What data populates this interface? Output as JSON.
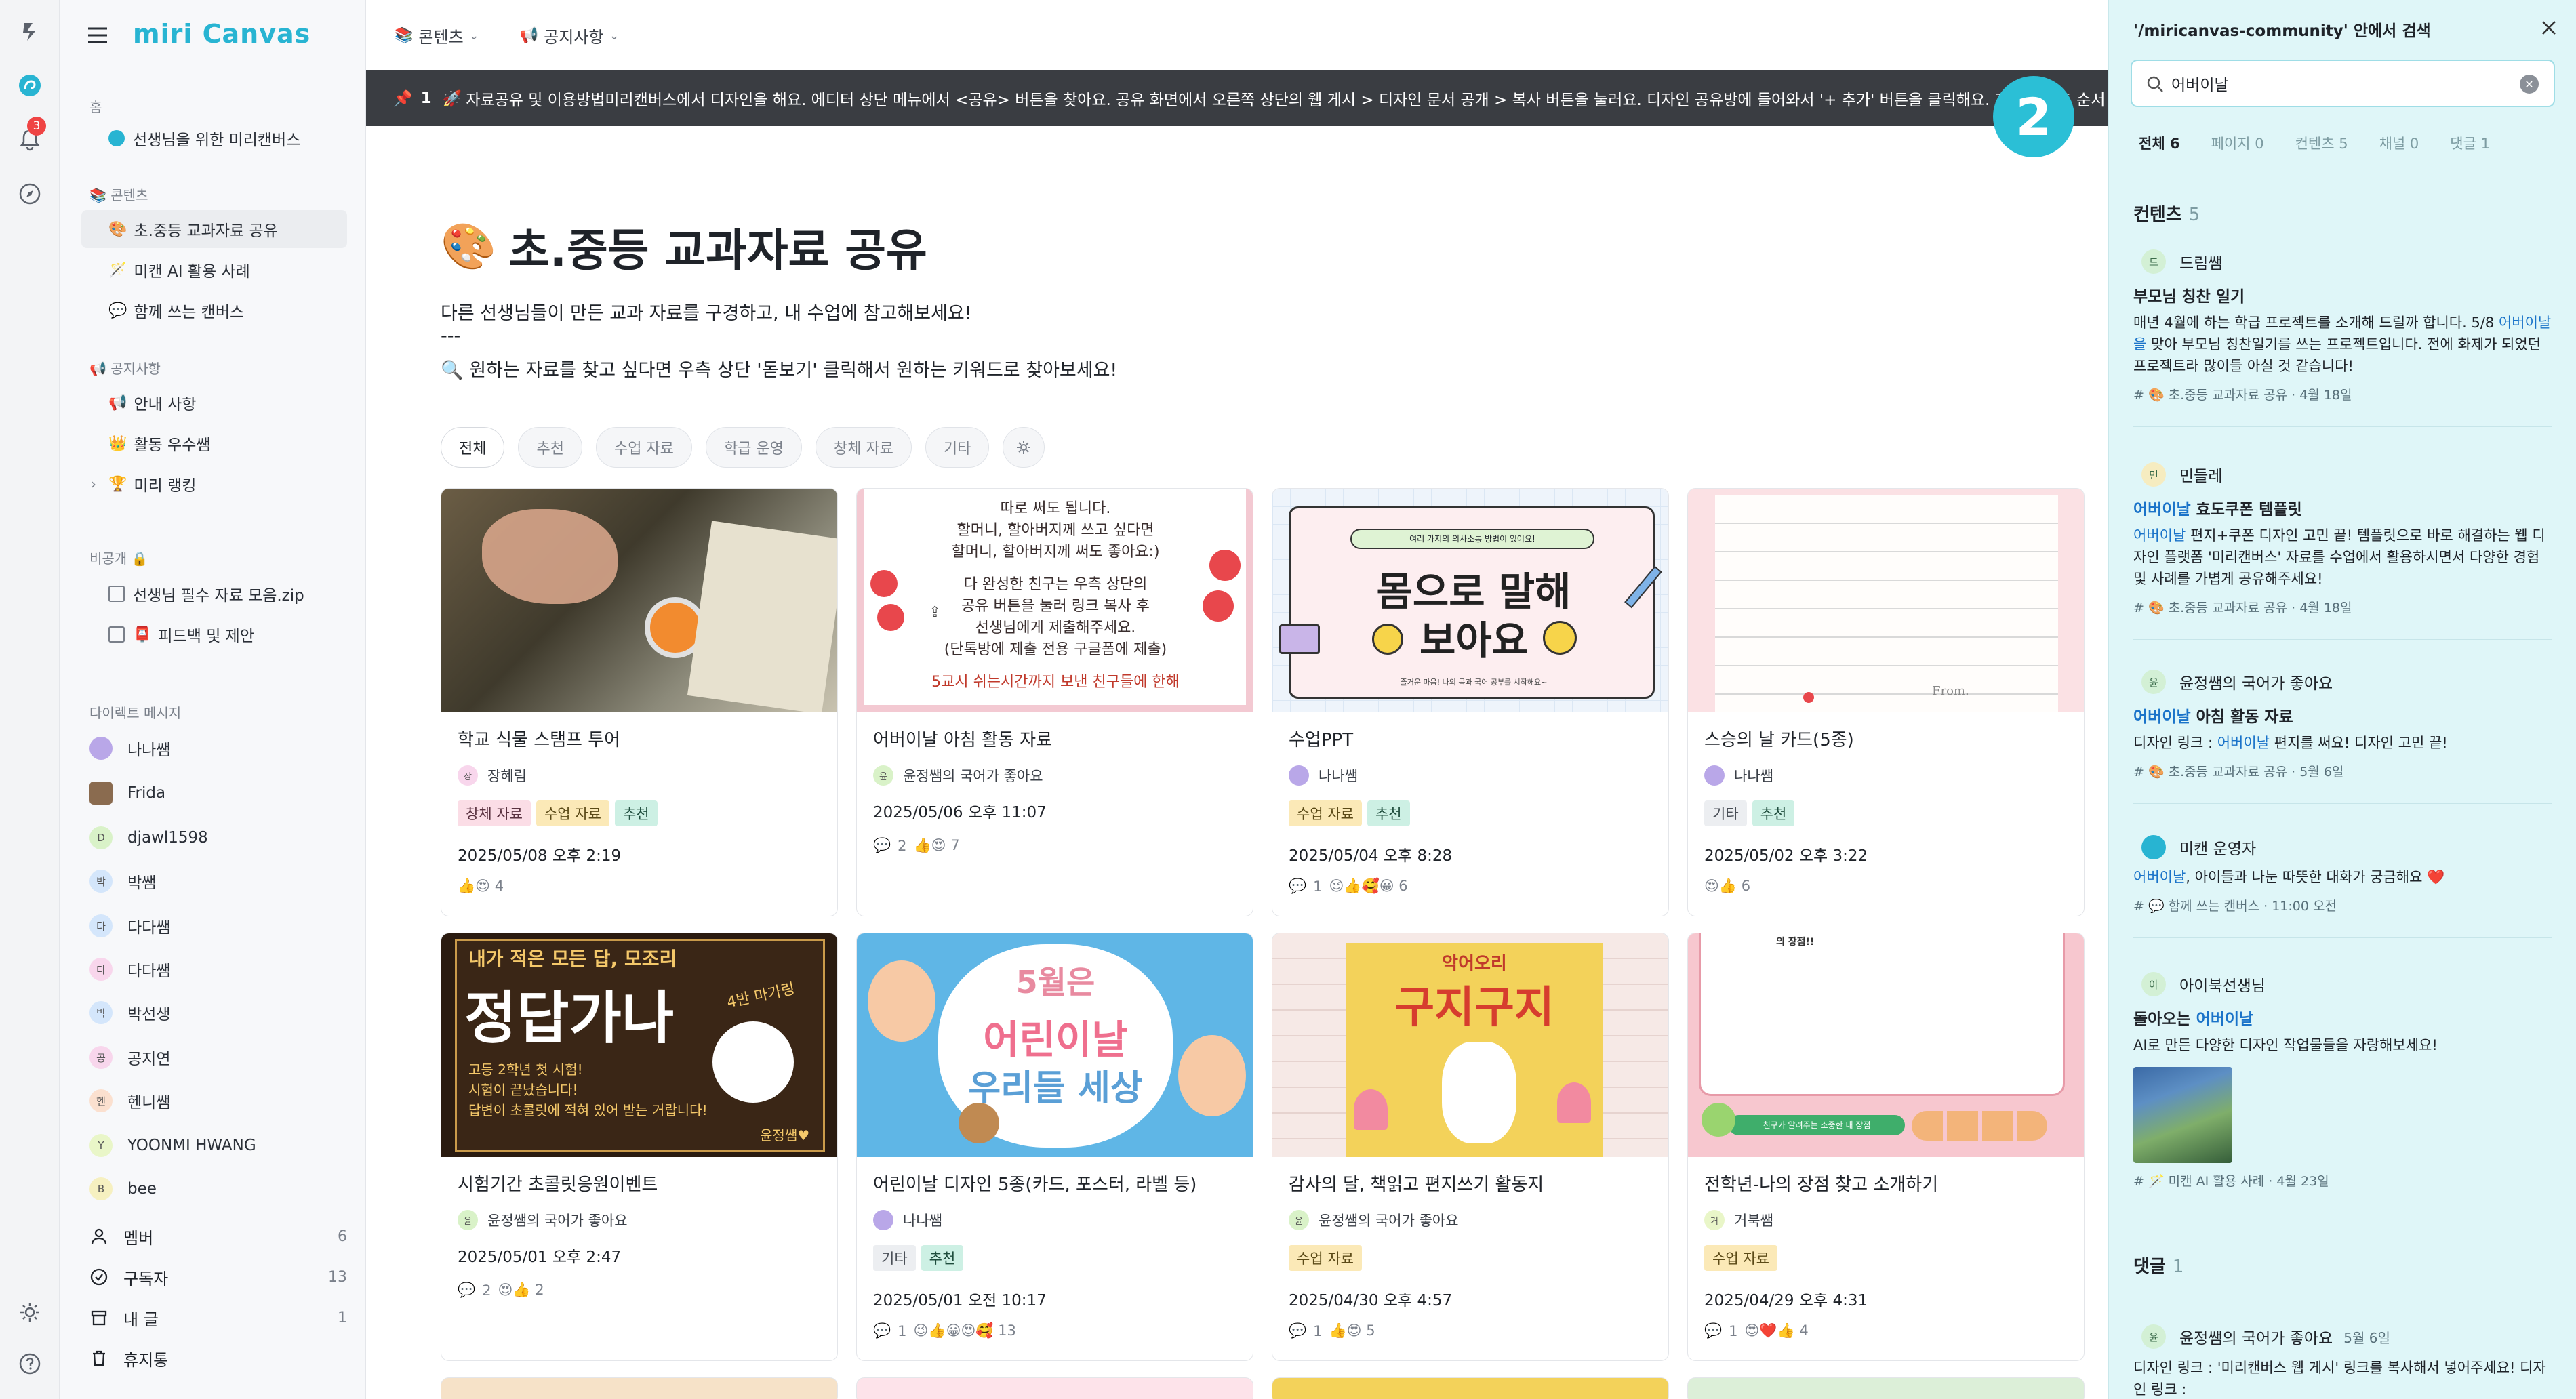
{
  "app": {
    "logo": "miri Canvas",
    "notif_count": "3"
  },
  "sidebar": {
    "home_label": "홈",
    "home_item": "선생님을 위한 미리캔버스",
    "content_label": "콘텐츠",
    "content_items": [
      "초.중등 교과자료 공유",
      "미캔 AI 활용 사례",
      "함께 쓰는 캔버스"
    ],
    "notice_label": "공지사항",
    "notice_items": [
      "안내 사항",
      "활동 우수쌤",
      "미리 랭킹"
    ],
    "private_label": "비공개",
    "private_items": [
      "선생님 필수 자료 모음.zip",
      "피드백 및 제안"
    ],
    "dm_label": "다이렉트 메시지",
    "dms": [
      {
        "name": "나나쌤",
        "av": ""
      },
      {
        "name": "Frida",
        "av": ""
      },
      {
        "name": "djawl1598",
        "av": "D"
      },
      {
        "name": "박쌤",
        "av": "박"
      },
      {
        "name": "다다쌤",
        "av": "다"
      },
      {
        "name": "다다쌤",
        "av": "다"
      },
      {
        "name": "박선생",
        "av": "박"
      },
      {
        "name": "공지연",
        "av": "공"
      },
      {
        "name": "헨니쌤",
        "av": "헨"
      },
      {
        "name": "YOONMI HWANG",
        "av": "Y"
      },
      {
        "name": "bee",
        "av": "B"
      }
    ],
    "bottom": [
      {
        "label": "멤버",
        "count": "6"
      },
      {
        "label": "구독자",
        "count": "13"
      },
      {
        "label": "내 글",
        "count": "1"
      },
      {
        "label": "휴지통",
        "count": ""
      }
    ]
  },
  "topbar": {
    "content_menu": "콘텐츠",
    "notice_menu": "공지사항"
  },
  "announce": {
    "num": "1",
    "text": "자료공유 및 이용방법미리캔버스에서 디자인을 해요. 에디터 상단 메뉴에서 <공유> 버튼을 찾아요. 공유 화면에서 오른쪽 상단의 웹 게시 > 디자인 문서 공개 > 복사 버튼을 눌러요. 디자인 공유방에 들어와서 '+ 추가' 버튼을 클릭해요. 자료 업로드 순서"
  },
  "step_badge": "2",
  "main": {
    "title": "초.중등 교과자료 공유",
    "desc1": "다른 선생님들이 만든 교과 자료를 구경하고, 내 수업에 참고해보세요!",
    "desc2": "---",
    "desc3": "🔍 원하는 자료를 찾고 싶다면 우측 상단 '돋보기' 클릭해서 원하는 키워드로 찾아보세요!",
    "filters": [
      "전체",
      "추천",
      "수업 자료",
      "학급 운영",
      "창체 자료",
      "기타"
    ]
  },
  "cards": [
    {
      "title": "학교 식물 스탬프 투어",
      "author": "장혜림",
      "av": "장",
      "tags": [
        [
          "창체 자료",
          "pink"
        ],
        [
          "수업 자료",
          "yellow"
        ],
        [
          "추천",
          "green"
        ]
      ],
      "date": "2025/05/08 오후 2:19",
      "comments": "",
      "reactions": "👍😍 4"
    },
    {
      "title": "어버이날 아침 활동 자료",
      "author": "윤정쌤의 국어가 좋아요",
      "av": "윤",
      "tags": [],
      "date": "2025/05/06 오후 11:07",
      "comments": "2",
      "reactions": "👍😍 7"
    },
    {
      "title": "수업PPT",
      "author": "나나쌤",
      "av": "",
      "tags": [
        [
          "수업 자료",
          "yellow"
        ],
        [
          "추천",
          "green"
        ]
      ],
      "date": "2025/05/04 오후 8:28",
      "comments": "1",
      "reactions": "😉👍🥰😀 6"
    },
    {
      "title": "스승의 날 카드(5종)",
      "author": "나나쌤",
      "av": "",
      "tags": [
        [
          "기타",
          "gray"
        ],
        [
          "추천",
          "green"
        ]
      ],
      "date": "2025/05/02 오후 3:22",
      "comments": "",
      "reactions": "😍👍 6"
    },
    {
      "title": "시험기간 초콜릿응원이벤트",
      "author": "윤정쌤의 국어가 좋아요",
      "av": "윤",
      "tags": [],
      "date": "2025/05/01 오후 2:47",
      "comments": "2",
      "reactions": "😍👍 2"
    },
    {
      "title": "어린이날 디자인 5종(카드, 포스터, 라벨 등)",
      "author": "나나쌤",
      "av": "",
      "tags": [
        [
          "기타",
          "gray"
        ],
        [
          "추천",
          "green"
        ]
      ],
      "date": "2025/05/01 오전 10:17",
      "comments": "1",
      "reactions": "😉👍😀😍🥰 13"
    },
    {
      "title": "감사의 달, 책읽고 편지쓰기 활동지",
      "author": "윤정쌤의 국어가 좋아요",
      "av": "윤",
      "tags": [
        [
          "수업 자료",
          "yellow"
        ]
      ],
      "date": "2025/04/30 오후 4:57",
      "comments": "1",
      "reactions": "👍😍 5"
    },
    {
      "title": "전학년-나의 장점 찾고 소개하기",
      "author": "거북쌤",
      "av": "거",
      "tags": [
        [
          "수업 자료",
          "yellow"
        ]
      ],
      "date": "2025/04/29 오후 4:31",
      "comments": "1",
      "reactions": "😍❤️👍 4"
    }
  ],
  "thumbs": {
    "t2_lines": [
      "따로 써도 됩니다.",
      "할머니, 할아버지께 쓰고 싶다면",
      "할머니, 할아버지께 써도 좋아요:)",
      "다 완성한 친구는 우측 상단의",
      "공유 버튼을 눌러 링크 복사 후",
      "선생님에게 제출해주세요.",
      "(단톡방에 제출 전용 구글폼에 제출)",
      "5교시 쉬는시간까지 보낸 친구들에 한해"
    ],
    "t3_top": "여러 가지의 의사소통 방법이 있어요!",
    "t3_main1": "몸으로 말해",
    "t3_main2": "보아요",
    "t3_sub": "즐거운 마음! 나의 몸과 국어 공부를 시작해요~",
    "t4_from": "From.",
    "t5_top": "내가 적은 모든 답, 모조리",
    "t5_main": "정답가나",
    "t5_side": "4반 마가링",
    "t5_lines": [
      "고등 2학년 첫 시험!",
      "시험이 끝났습니다!",
      "답변이 초콜릿에 적혀 있어 받는 거랍니다!"
    ],
    "t5_sig": "윤정쌤♥",
    "t6_l1": "5월은",
    "t6_l2": "어린이날",
    "t6_l3": "우리들 세상",
    "t7_top": "악어오리",
    "t7_main": "구지구지",
    "t8_top": "의 장점!!",
    "t8_banner": "친구가 알려주는 소중한 내 장점"
  },
  "panel": {
    "title": "'/miricanvas-community' 안에서 검색",
    "query": "어버이날",
    "tabs": [
      "전체 6",
      "페이지 0",
      "컨텐츠 5",
      "채널 0",
      "댓글 1"
    ],
    "content_label": "컨텐츠",
    "content_count": "5",
    "comment_label": "댓글",
    "comment_count": "1",
    "results": [
      {
        "author": "드림쌤",
        "av": "드",
        "title": "부모님 칭찬 일기",
        "body_pre": "매년 4월에 하는 학급 프로젝트를 소개해 드릴까 합니다. 5/8 ",
        "body_hl": "어버이날을",
        "body_post": " 맞아 부모님 칭찬일기를 쓰는 프로젝트입니다. 전에 화제가 되었던 프로젝트라 많이들 아실 것 같습니다!",
        "meta": "# 🎨 초.중등 교과자료 공유 · 4월 18일"
      },
      {
        "author": "민들레",
        "av": "민",
        "title_hl": "어버이날",
        "title_post": " 효도쿠폰 템플릿",
        "body_hl": "어버이날",
        "body_post": " 편지+쿠폰 디자인 고민 끝! 템플릿으로 바로 해결하는 웹 디자인 플랫폼 '미리캔버스' 자료를 수업에서 활용하시면서 다양한 경험 및 사례를 가볍게 공유해주세요!",
        "meta": "# 🎨 초.중등 교과자료 공유 · 4월 18일"
      },
      {
        "author": "윤정쌤의 국어가 좋아요",
        "av": "윤",
        "title_hl": "어버이날",
        "title_post": " 아침 활동 자료",
        "body_pre": "디자인 링크 : ",
        "body_hl": "어버이날",
        "body_post": " 편지를 써요! 디자인 고민 끝!",
        "meta": "# 🎨 초.중등 교과자료 공유 · 5월 6일"
      },
      {
        "author": "미캔 운영자",
        "av": "",
        "body_hl": "어버이날",
        "body_post": ", 아이들과 나눈 따뜻한 대화가 궁금해요 ❤️",
        "meta": "# 💬 함께 쓰는 캔버스 · 11:00 오전"
      },
      {
        "author": "아이북선생님",
        "av": "아",
        "title_pre": "돌아오는 ",
        "title_hl": "어버이날",
        "body_post": "AI로 만든 다양한 디자인 작업물들을 자랑해보세요!",
        "meta": "# 🪄 미캔 AI 활용 사례 · 4월 23일"
      }
    ],
    "comment": {
      "author": "윤정쌤의 국어가 좋아요",
      "date": "5월 6일",
      "av": "윤",
      "body": "디자인 링크 : '미리캔버스 웹 게시' 링크를 복사해서 넣어주세요! 디자인 링크 :"
    }
  },
  "colors": {
    "accent": "#28b4d2",
    "panel_bg": "#dff6f8",
    "highlight": "#1a73c9",
    "announce_bg": "#3a3d42"
  }
}
